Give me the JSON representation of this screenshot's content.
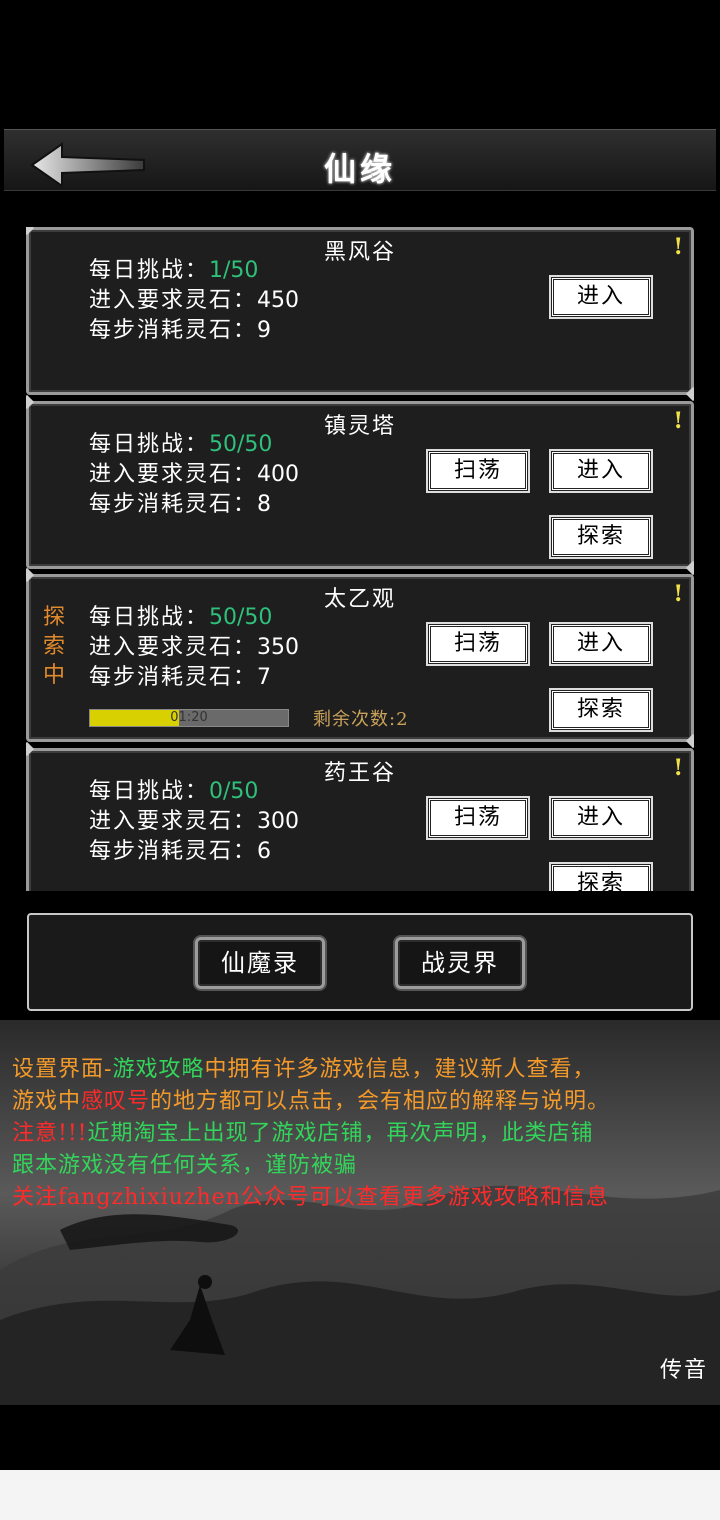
{
  "header": {
    "title": "仙缘"
  },
  "cards": [
    {
      "name": "黑风谷",
      "daily_label": "每日挑战：",
      "daily_value": "1/50",
      "req_label": "进入要求灵石：",
      "req_value": "450",
      "cost_label": "每步消耗灵石：",
      "cost_value": "9",
      "warn": "!",
      "enter": "进入"
    },
    {
      "name": "镇灵塔",
      "daily_label": "每日挑战：",
      "daily_value": "50/50",
      "req_label": "进入要求灵石：",
      "req_value": "400",
      "cost_label": "每步消耗灵石：",
      "cost_value": "8",
      "warn": "!",
      "sweep": "扫荡",
      "enter": "进入",
      "explore": "探索"
    },
    {
      "name": "太乙观",
      "status": "探索中",
      "daily_label": "每日挑战：",
      "daily_value": "50/50",
      "req_label": "进入要求灵石：",
      "req_value": "350",
      "cost_label": "每步消耗灵石：",
      "cost_value": "7",
      "warn": "!",
      "sweep": "扫荡",
      "enter": "进入",
      "explore": "探索",
      "timer": "01:20",
      "progress": 0.45,
      "remaining": "剩余次数:2"
    },
    {
      "name": "药王谷",
      "daily_label": "每日挑战：",
      "daily_value": "0/50",
      "req_label": "进入要求灵石：",
      "req_value": "300",
      "cost_label": "每步消耗灵石：",
      "cost_value": "6",
      "warn": "!",
      "sweep": "扫荡",
      "enter": "进入",
      "explore": "探索"
    }
  ],
  "bottom": {
    "xianmolu": "仙魔录",
    "zhanlingjie": "战灵界"
  },
  "notice": {
    "l1a": "设置界面-",
    "l1b": "游戏攻略",
    "l1c": "中拥有许多游戏信息，建议新人查看，",
    "l2a": "游戏中",
    "l2b": "感叹号",
    "l2c": "的地方都可以点击，会有相应的解释与说明。",
    "l3a": "注意!!!",
    "l3b": "近期淘宝上出现了游戏店铺，再次声明，此类店铺",
    "l4": "跟本游戏没有任何关系，谨防被骗",
    "l5": "关注fangzhixiuzhen公众号可以查看更多游戏攻略和信息"
  },
  "broadcast": "传音",
  "colors": {
    "green_value": "#2fc07a",
    "exploring": "#e08a2c",
    "progress_fill": "#d8d000",
    "warn": "#f2e24a"
  }
}
